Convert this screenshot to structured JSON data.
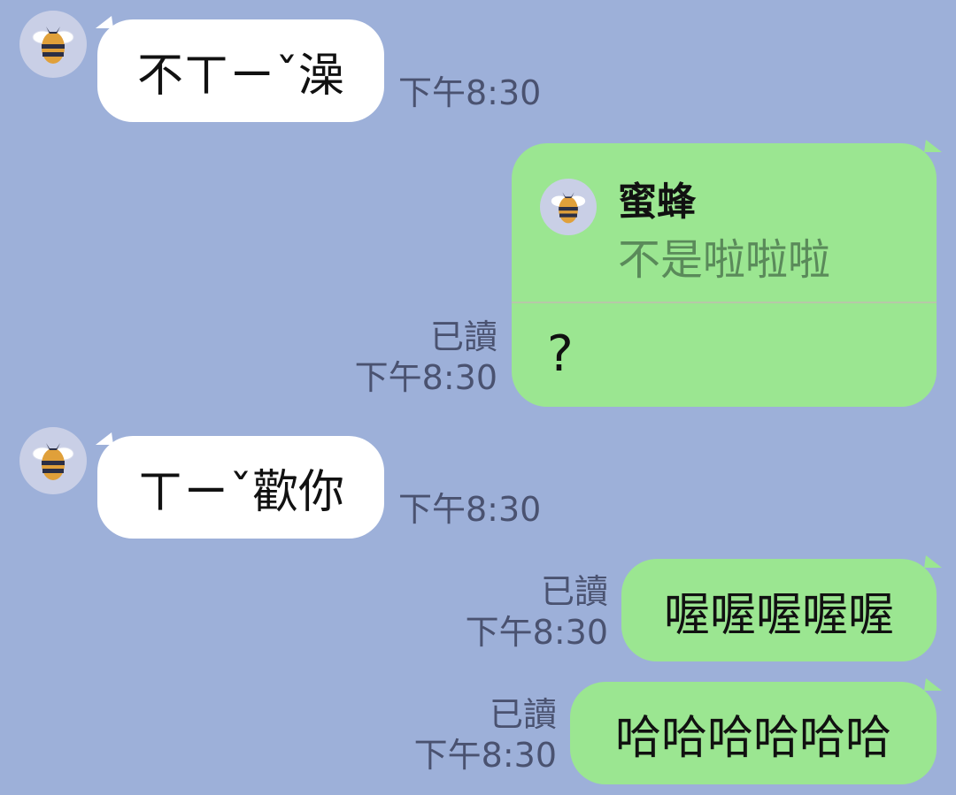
{
  "contact": {
    "name": "蜜蜂",
    "avatar_icon": "bee-icon"
  },
  "colors": {
    "background": "#9db0d9",
    "incoming": "#ffffff",
    "outgoing": "#9be691",
    "meta": "#4a5270"
  },
  "messages": [
    {
      "direction": "in",
      "text": "不ㄒㄧˇ澡",
      "time": "下午8:30"
    },
    {
      "direction": "out",
      "reply_to": {
        "name": "蜜蜂",
        "text": "不是啦啦啦"
      },
      "text": "?",
      "read": "已讀",
      "time": "下午8:30"
    },
    {
      "direction": "in",
      "text": "ㄒㄧˇ歡你",
      "time": "下午8:30"
    },
    {
      "direction": "out",
      "text": "喔喔喔喔喔",
      "read": "已讀",
      "time": "下午8:30"
    },
    {
      "direction": "out",
      "text": "哈哈哈哈哈哈",
      "read": "已讀",
      "time": "下午8:30"
    }
  ]
}
